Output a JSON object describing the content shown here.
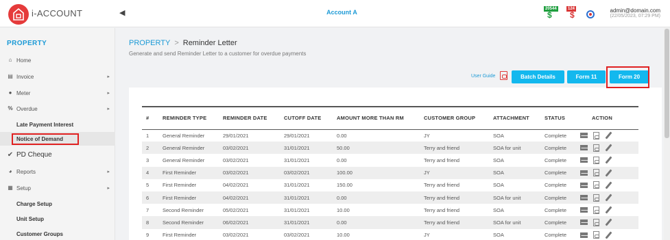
{
  "app": {
    "brand": "i-ACCOUNT",
    "account": "Account A"
  },
  "header": {
    "badge_green": "20544",
    "badge_red": "124",
    "user_email": "admin@domain.com",
    "user_time": "(22/05/2023, 07:29 PM)"
  },
  "sidebar": {
    "title": "PROPERTY",
    "items": [
      {
        "icon": "home-icon",
        "label": "Home"
      },
      {
        "icon": "invoice-icon",
        "label": "Invoice"
      },
      {
        "icon": "meter-icon",
        "label": "Meter"
      },
      {
        "icon": "percent-icon",
        "label": "Overdue"
      },
      {
        "label": "Late Payment Interest"
      },
      {
        "label": "Notice of Demand"
      },
      {
        "icon": "check-icon",
        "label": "PD Cheque"
      },
      {
        "icon": "reports-icon",
        "label": "Reports"
      },
      {
        "icon": "setup-icon",
        "label": "Setup"
      },
      {
        "label": "Charge Setup"
      },
      {
        "label": "Unit Setup"
      },
      {
        "label": "Customer Groups"
      }
    ]
  },
  "page": {
    "crumb_root": "PROPERTY",
    "crumb_sep": ">",
    "crumb_current": "Reminder Letter",
    "subtitle": "Generate and send Reminder Letter to a customer for overdue payments"
  },
  "toolbar": {
    "user_guide": "User Guide",
    "batch_details": "Batch Details",
    "form11": "Form 11",
    "form20": "Form 20"
  },
  "table": {
    "headers": [
      "#",
      "REMINDER TYPE",
      "REMINDER DATE",
      "CUTOFF DATE",
      "AMOUNT MORE THAN RM",
      "CUSTOMER GROUP",
      "ATTACHMENT",
      "STATUS",
      "ACTION"
    ],
    "rows": [
      [
        "1",
        "General Reminder",
        "29/01/2021",
        "29/01/2021",
        "0.00",
        "JY",
        "SOA",
        "Complete"
      ],
      [
        "2",
        "General Reminder",
        "03/02/2021",
        "31/01/2021",
        "50.00",
        "Terry and friend",
        "SOA for unit",
        "Complete"
      ],
      [
        "3",
        "General Reminder",
        "03/02/2021",
        "31/01/2021",
        "0.00",
        "Terry and friend",
        "SOA",
        "Complete"
      ],
      [
        "4",
        "First Reminder",
        "03/02/2021",
        "03/02/2021",
        "100.00",
        "JY",
        "SOA",
        "Complete"
      ],
      [
        "5",
        "First Reminder",
        "04/02/2021",
        "31/01/2021",
        "150.00",
        "Terry and friend",
        "SOA",
        "Complete"
      ],
      [
        "6",
        "First Reminder",
        "04/02/2021",
        "31/01/2021",
        "0.00",
        "Terry and friend",
        "SOA for unit",
        "Complete"
      ],
      [
        "7",
        "Second Reminder",
        "05/02/2021",
        "31/01/2021",
        "10.00",
        "Terry and friend",
        "SOA",
        "Complete"
      ],
      [
        "8",
        "Second Reminder",
        "06/02/2021",
        "31/01/2021",
        "0.00",
        "Terry and friend",
        "SOA for unit",
        "Complete"
      ],
      [
        "9",
        "First Reminder",
        "03/02/2021",
        "03/02/2021",
        "10.00",
        "JY",
        "SOA",
        "Complete"
      ]
    ]
  }
}
